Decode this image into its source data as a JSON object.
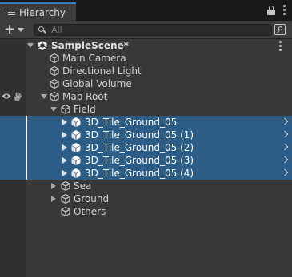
{
  "window": {
    "tab_title": "Hierarchy",
    "tab_icon": "hierarchy-list-icon",
    "lock_icon": "lock-icon",
    "menu_icon": "kebab-menu-icon"
  },
  "toolbar": {
    "add_icon": "plus-icon",
    "search_placeholder": "All",
    "search_icon": "search-icon",
    "scene_search_icon": "scene-search-icon"
  },
  "tree": {
    "scene": {
      "label": "SampleScene*",
      "icon": "unity-scene-icon",
      "expanded": true
    },
    "items": [
      {
        "label": "Main Camera",
        "icon": "gameobject-cube-icon",
        "depth": 1
      },
      {
        "label": "Directional Light",
        "icon": "gameobject-cube-icon",
        "depth": 1
      },
      {
        "label": "Global Volume",
        "icon": "gameobject-cube-icon",
        "depth": 1
      },
      {
        "label": "Map Root",
        "icon": "gameobject-cube-icon",
        "depth": 1,
        "expanded": true,
        "visibility_icon": "eye-icon",
        "pickable_icon": "hand-icon"
      },
      {
        "label": "Field",
        "icon": "gameobject-cube-icon",
        "depth": 2,
        "expanded": true
      },
      {
        "label": "3D_Tile_Ground_05",
        "icon": "prefab-cube-icon",
        "depth": 3,
        "selected": true,
        "collapsed": true
      },
      {
        "label": "3D_Tile_Ground_05 (1)",
        "icon": "prefab-cube-icon",
        "depth": 3,
        "selected": true,
        "collapsed": true
      },
      {
        "label": "3D_Tile_Ground_05 (2)",
        "icon": "prefab-cube-icon",
        "depth": 3,
        "selected": true,
        "collapsed": true
      },
      {
        "label": "3D_Tile_Ground_05 (3)",
        "icon": "prefab-cube-icon",
        "depth": 3,
        "selected": true,
        "collapsed": true
      },
      {
        "label": "3D_Tile_Ground_05 (4)",
        "icon": "prefab-cube-icon",
        "depth": 3,
        "selected": true,
        "collapsed": true
      },
      {
        "label": "Sea",
        "icon": "gameobject-cube-icon",
        "depth": 2,
        "collapsed": true
      },
      {
        "label": "Ground",
        "icon": "gameobject-cube-icon",
        "depth": 2,
        "collapsed": true
      },
      {
        "label": "Others",
        "icon": "gameobject-cube-icon",
        "depth": 2
      }
    ]
  },
  "colors": {
    "selection": "#2c5d87",
    "tab_accent": "#3a79bb",
    "background": "#383838"
  }
}
